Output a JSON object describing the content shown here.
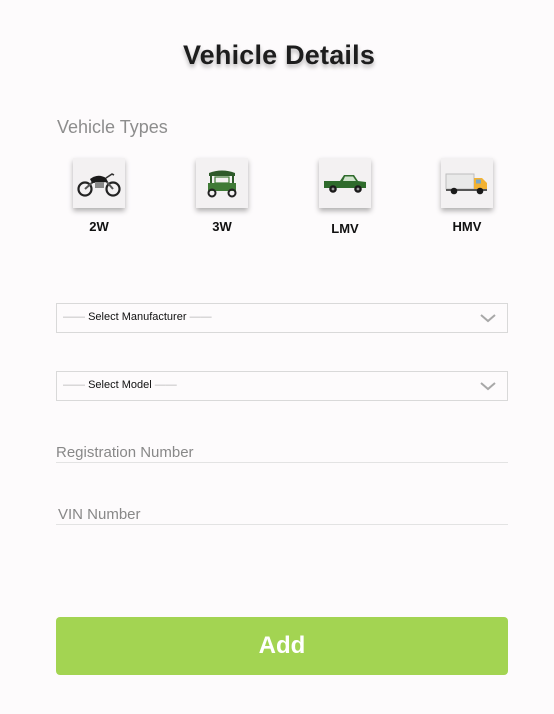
{
  "header": {
    "title": "Vehicle Details"
  },
  "vehicle_types": {
    "label": "Vehicle Types",
    "items": [
      {
        "label": "2W",
        "icon": "motorcycle-icon"
      },
      {
        "label": "3W",
        "icon": "auto-rickshaw-icon"
      },
      {
        "label": "LMV",
        "icon": "pickup-truck-icon"
      },
      {
        "label": "HMV",
        "icon": "cargo-truck-icon"
      }
    ]
  },
  "form": {
    "manufacturer": {
      "value": "Select Manufacturer",
      "dash": "——"
    },
    "model": {
      "value": "Select Model",
      "dash": "——"
    },
    "registration": {
      "placeholder": "Registration Number"
    },
    "vin": {
      "placeholder": "VIN Number"
    }
  },
  "actions": {
    "add_label": "Add"
  },
  "colors": {
    "accent": "#a3d452",
    "title": "#1d1d1d",
    "placeholder": "#888888"
  }
}
